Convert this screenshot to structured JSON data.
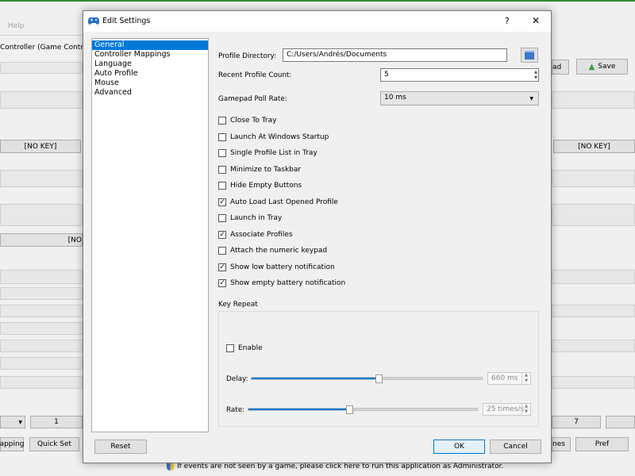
{
  "background_window": {
    "menu_help": "Help",
    "controller_label": "Controller (Game Controller",
    "save_label": "Save",
    "load_partial": "ad",
    "no_key_left": "[NO KEY]",
    "no_key_right": "[NO KEY]",
    "no_key_mid": "[NO",
    "tab_one": "1",
    "tab_seven": "7",
    "mapping_partial": "apping",
    "quick_set": "Quick Set",
    "themes_partial": "nes",
    "pref": "Pref",
    "status_message": "If events are not seen by a game, please click here to run this application as Administrator."
  },
  "dialog": {
    "title": "Edit Settings",
    "help_button": "?",
    "close_button": "✕",
    "categories": [
      "General",
      "Controller Mappings",
      "Language",
      "Auto Profile",
      "Mouse",
      "Advanced"
    ],
    "selected_category": "General",
    "profile_directory_label": "Profile Directory:",
    "profile_directory_value": "C:/Users/Andrés/Documents",
    "recent_profile_count_label": "Recent Profile Count:",
    "recent_profile_count_value": "5",
    "poll_rate_label": "Gamepad Poll Rate:",
    "poll_rate_value": "10 ms",
    "options": [
      {
        "label": "Close To Tray",
        "checked": false
      },
      {
        "label": "Launch At Windows Startup",
        "checked": false
      },
      {
        "label": "Single Profile List in Tray",
        "checked": false
      },
      {
        "label": "Minimize to Taskbar",
        "checked": false
      },
      {
        "label": "Hide Empty Buttons",
        "checked": false
      },
      {
        "label": "Auto Load Last Opened Profile",
        "checked": true
      },
      {
        "label": "Launch in Tray",
        "checked": false
      },
      {
        "label": "Associate Profiles",
        "checked": true
      },
      {
        "label": "Attach the numeric keypad",
        "checked": false
      },
      {
        "label": "Show low battery notification",
        "checked": true
      },
      {
        "label": "Show empty battery notification",
        "checked": true
      }
    ],
    "key_repeat": {
      "group_label": "Key Repeat",
      "enable_label": "Enable",
      "enable_checked": false,
      "delay_label": "Delay:",
      "delay_value": "660 ms",
      "delay_fraction": 0.55,
      "rate_label": "Rate:",
      "rate_value": "25 times/s",
      "rate_fraction": 0.44
    },
    "reset_label": "Reset",
    "ok_label": "OK",
    "cancel_label": "Cancel"
  }
}
